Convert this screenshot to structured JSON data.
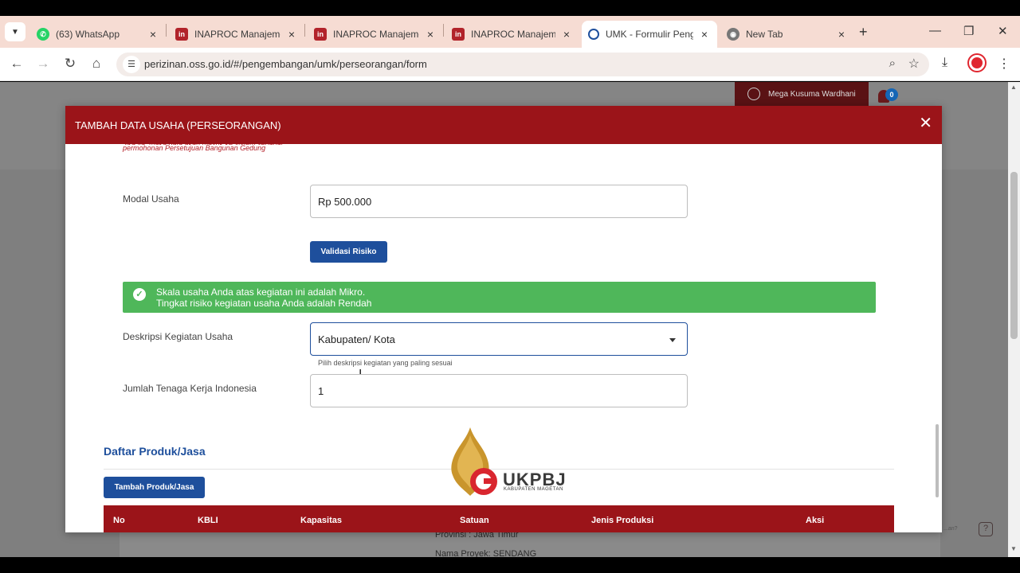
{
  "browser": {
    "tabs": [
      {
        "label": "(63) WhatsApp",
        "icon": "whatsapp-icon"
      },
      {
        "label": "INAPROC Manajemen",
        "icon": "inaproc-icon"
      },
      {
        "label": "INAPROC Manajemen",
        "icon": "inaproc-icon"
      },
      {
        "label": "INAPROC Manajemen",
        "icon": "inaproc-icon"
      },
      {
        "label": "UMK - Formulir Pengajuan",
        "icon": "oss-icon",
        "active": true
      },
      {
        "label": "New Tab",
        "icon": "chrome-icon"
      }
    ],
    "url": "perizinan.oss.go.id/#/pengembangan/umk/perseorangan/form"
  },
  "header": {
    "user_name": "Mega Kusuma Wardhani",
    "notification_count": "0"
  },
  "background": {
    "line1": "Provinsi : Jawa Timur",
    "line2": "Nama Proyek: SENDANG",
    "help_text": "...an?"
  },
  "modal": {
    "title": "TAMBAH DATA USAHA (PERSEORANGAN)",
    "hint_partial": "Jika ya, maka data akan masuk ke sistem sebagai",
    "hint": "permohonan Persetujuan Bangunan Gedung",
    "modal_usaha": {
      "label": "Modal Usaha",
      "value": "Rp 500.000"
    },
    "validate_button": "Validasi Risiko",
    "alert": {
      "line1": "Skala usaha Anda atas kegiatan ini adalah Mikro.",
      "line2": "Tingkat risiko kegiatan usaha Anda adalah Rendah",
      "color": "#4fb75a"
    },
    "deskripsi": {
      "label": "Deskripsi Kegiatan Usaha",
      "value": "Kabupaten/ Kota",
      "help": "Pilih deskripsi kegiatan yang paling sesuai"
    },
    "tenaga_kerja": {
      "label": "Jumlah Tenaga Kerja Indonesia",
      "value": "1"
    },
    "produk": {
      "section_title": "Daftar Produk/Jasa",
      "add_button": "Tambah Produk/Jasa",
      "columns": [
        "No",
        "KBLI",
        "Kapasitas",
        "Satuan",
        "Jenis Produksi",
        "Aksi"
      ]
    }
  },
  "watermark": {
    "name": "UKPBJ",
    "subtitle": "KABUPATEN MAGETAN"
  },
  "colors": {
    "brand_red": "#9b1419",
    "primary_blue": "#1e4f9c"
  }
}
